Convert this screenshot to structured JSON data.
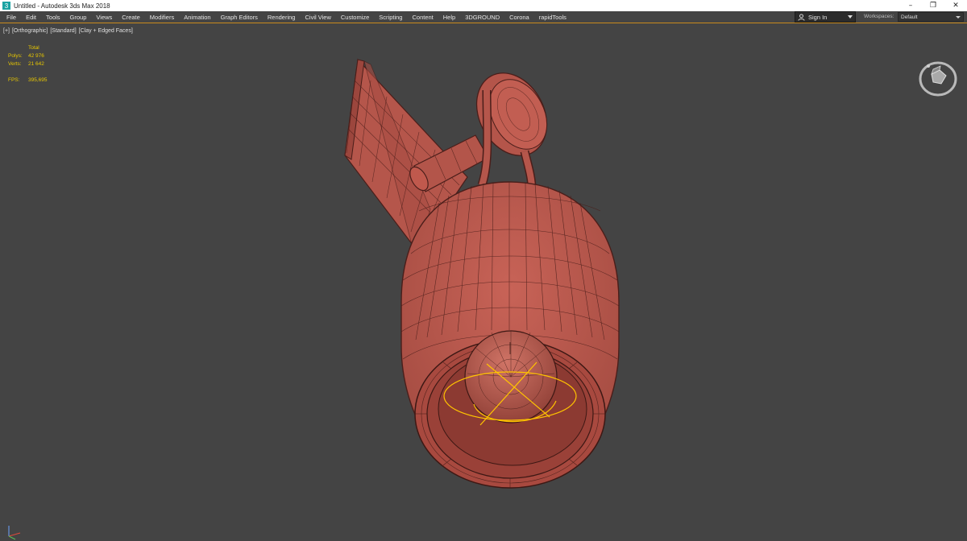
{
  "window": {
    "title": "Untitled - Autodesk 3ds Max 2018",
    "controls": {
      "minimize": "–",
      "restore": "❐",
      "close": "✕"
    }
  },
  "menubar": {
    "items": [
      "File",
      "Edit",
      "Tools",
      "Group",
      "Views",
      "Create",
      "Modifiers",
      "Animation",
      "Graph Editors",
      "Rendering",
      "Civil View",
      "Customize",
      "Scripting",
      "Content",
      "Help",
      "3DGROUND",
      "Corona",
      "rapidTools"
    ]
  },
  "account": {
    "sign_in_label": "Sign In",
    "icon": "user-icon"
  },
  "workspaces": {
    "label": "Workspaces:",
    "selected": "Default"
  },
  "viewport": {
    "label_plus": "[+]",
    "label_view": "[Orthographic]",
    "label_shading_preset": "[Standard]",
    "label_shading": "[Clay + Edged Faces]",
    "stats": {
      "header": "Total",
      "polys_label": "Polys:",
      "polys_value": "42 976",
      "verts_label": "Verts:",
      "verts_value": "21 642",
      "fps_label": "FPS:",
      "fps_value": "395,695"
    },
    "model_color": "#b8574c",
    "wire_color": "#4a1e1a",
    "selection_color": "#ffc400",
    "stats_color": "#e8c700",
    "accent_line_color": "#c98a1c"
  }
}
